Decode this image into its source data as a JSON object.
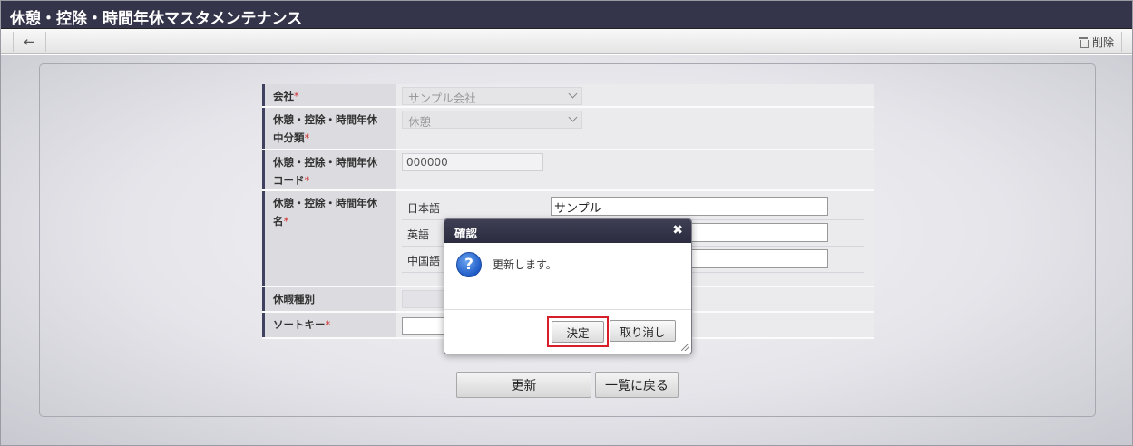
{
  "window": {
    "title": "休憩・控除・時間年休マスタメンテナンス"
  },
  "toolbar": {
    "back_icon": "arrow-left-icon",
    "delete_label": "削除",
    "delete_icon": "trash-icon"
  },
  "form": {
    "required_mark": "*",
    "company": {
      "label": "会社",
      "value": "サンプル会社"
    },
    "category": {
      "label_line1": "休憩・控除・時間年休",
      "label_line2": "中分類",
      "value": "休憩"
    },
    "code": {
      "label_line1": "休憩・控除・時間年休",
      "label_line2": "コード",
      "value": "000000"
    },
    "name": {
      "label_line1": "休憩・控除・時間年休",
      "label_line2": "名",
      "languages": [
        {
          "label": "日本語",
          "value": "サンプル"
        },
        {
          "label": "英語",
          "value": ""
        },
        {
          "label": "中国語",
          "value": ""
        }
      ]
    },
    "leave_type": {
      "label": "休暇種別",
      "value": ""
    },
    "sort_key": {
      "label": "ソートキー",
      "value": ""
    }
  },
  "actions": {
    "update_label": "更新",
    "back_to_list_label": "一覧に戻る"
  },
  "dialog": {
    "title": "確認",
    "close_icon": "close-icon",
    "icon": "question-icon",
    "icon_glyph": "?",
    "message": "更新します。",
    "ok_label": "決定",
    "cancel_label": "取り消し",
    "highlight_color": "#d81e2a"
  }
}
